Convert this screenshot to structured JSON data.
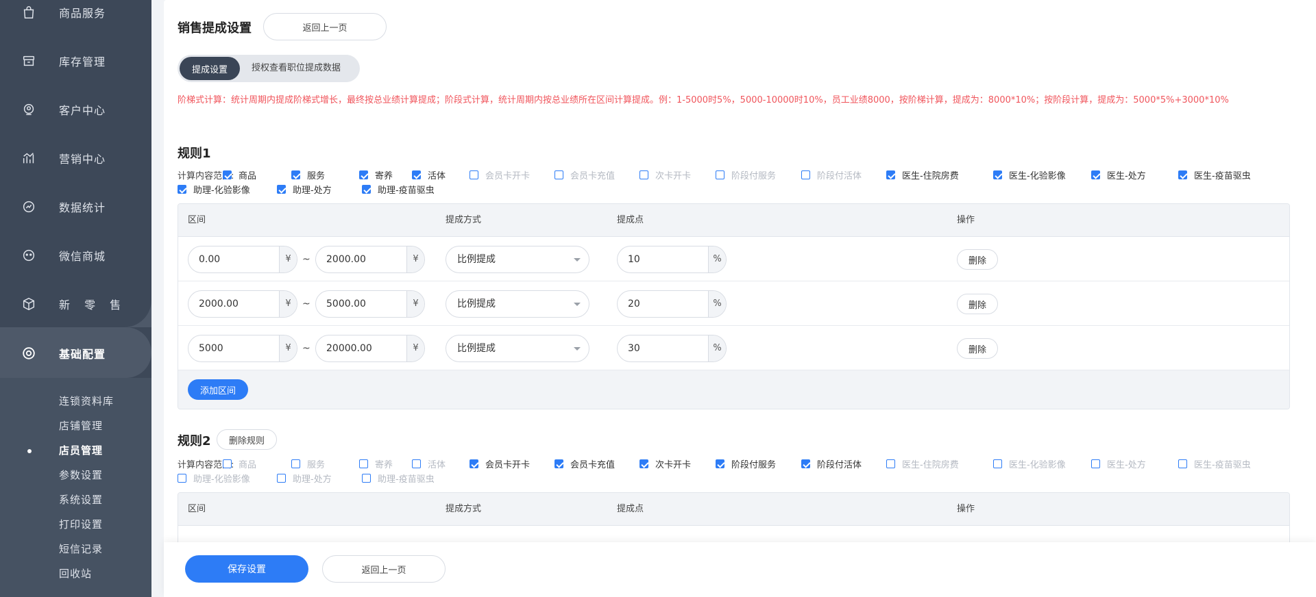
{
  "sidebar": {
    "items": [
      {
        "label": "商品服务",
        "icon": "bag-icon"
      },
      {
        "label": "库存管理",
        "icon": "box-icon"
      },
      {
        "label": "客户中心",
        "icon": "customer-icon"
      },
      {
        "label": "营销中心",
        "icon": "chart-bars-icon"
      },
      {
        "label": "数据统计",
        "icon": "trend-icon"
      },
      {
        "label": "微信商城",
        "icon": "chat-icon"
      },
      {
        "label": "新 零 售",
        "icon": "cube-icon"
      },
      {
        "label": "基础配置",
        "icon": "settings-ring-icon"
      }
    ],
    "sub_items": [
      "连锁资料库",
      "店铺管理",
      "店员管理",
      "参数设置",
      "系统设置",
      "打印设置",
      "短信记录",
      "回收站"
    ]
  },
  "header": {
    "title": "销售提成设置",
    "back_label": "返回上一页"
  },
  "tabs": {
    "active": "提成设置",
    "other": "授权查看职位提成数据"
  },
  "hint": "阶梯式计算：统计周期内提成阶梯式增长，最终按总业绩计算提成；阶段式计算，统计周期内按总业绩所在区间计算提成。例：1-5000时5%，5000-10000时10%，员工业绩8000，按阶梯计算，提成为：8000*10%；按阶段计算，提成为：5000*5%+3000*10%",
  "rule1": {
    "title": "规则1",
    "scope_label": "计算内容范围:",
    "options": [
      {
        "label": "商品",
        "checked": true
      },
      {
        "label": "服务",
        "checked": true
      },
      {
        "label": "寄养",
        "checked": true
      },
      {
        "label": "活体",
        "checked": true
      },
      {
        "label": "会员卡开卡",
        "checked": false
      },
      {
        "label": "会员卡充值",
        "checked": false
      },
      {
        "label": "次卡开卡",
        "checked": false
      },
      {
        "label": "阶段付服务",
        "checked": false
      },
      {
        "label": "阶段付活体",
        "checked": false
      },
      {
        "label": "医生-住院房费",
        "checked": true
      },
      {
        "label": "医生-化验影像",
        "checked": true
      },
      {
        "label": "医生-处方",
        "checked": true
      },
      {
        "label": "医生-疫苗驱虫",
        "checked": true
      },
      {
        "label": "助理-化验影像",
        "checked": true
      },
      {
        "label": "助理-处方",
        "checked": true
      },
      {
        "label": "助理-疫苗驱虫",
        "checked": true
      }
    ],
    "columns": [
      "区间",
      "提成方式",
      "提成点",
      "操作"
    ],
    "rows": [
      {
        "from": "0.00",
        "to": "2000.00",
        "method": "比例提成",
        "rate": "10"
      },
      {
        "from": "2000.00",
        "to": "5000.00",
        "method": "比例提成",
        "rate": "20"
      },
      {
        "from": "5000",
        "to": "20000.00",
        "method": "比例提成",
        "rate": "30"
      }
    ],
    "currency": "¥",
    "percent": "%",
    "tilde": "~",
    "delete_label": "删除",
    "add_label": "添加区间"
  },
  "rule2": {
    "title": "规则2",
    "delete_rule_label": "删除规则",
    "scope_label": "计算内容范围:",
    "options": [
      {
        "label": "商品",
        "checked": false
      },
      {
        "label": "服务",
        "checked": false
      },
      {
        "label": "寄养",
        "checked": false
      },
      {
        "label": "活体",
        "checked": false
      },
      {
        "label": "会员卡开卡",
        "checked": true
      },
      {
        "label": "会员卡充值",
        "checked": true
      },
      {
        "label": "次卡开卡",
        "checked": true
      },
      {
        "label": "阶段付服务",
        "checked": true
      },
      {
        "label": "阶段付活体",
        "checked": true
      },
      {
        "label": "医生-住院房费",
        "checked": false
      },
      {
        "label": "医生-化验影像",
        "checked": false
      },
      {
        "label": "医生-处方",
        "checked": false
      },
      {
        "label": "医生-疫苗驱虫",
        "checked": false
      },
      {
        "label": "助理-化验影像",
        "checked": false
      },
      {
        "label": "助理-处方",
        "checked": false
      },
      {
        "label": "助理-疫苗驱虫",
        "checked": false
      }
    ],
    "columns": [
      "区间",
      "提成方式",
      "提成点",
      "操作"
    ]
  },
  "footer": {
    "save_label": "保存设置",
    "back_label": "返回上一页"
  },
  "colors": {
    "sidebar": "#3d4858",
    "primary": "#2d7cf6",
    "hint": "#f0555c"
  }
}
